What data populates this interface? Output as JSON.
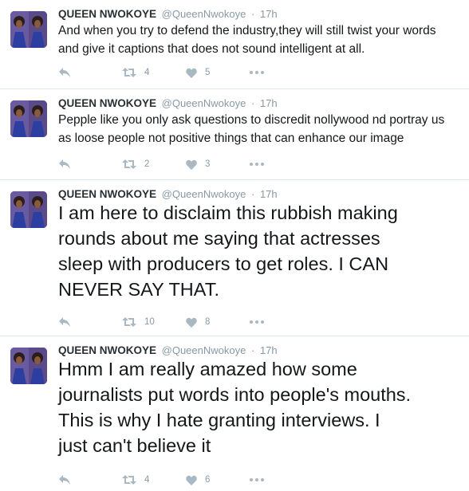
{
  "tweets": [
    {
      "name": "QUEEN NWOKOYE",
      "handle": "@QueenNwokoye",
      "separator": "·",
      "time": "17h",
      "text_line1": "And when you try to defend the industry,they will still twist your words",
      "text_line2": "and give it captions that does not sound intelligent at all.",
      "retweets": "4",
      "likes": "5"
    },
    {
      "name": "QUEEN NWOKOYE",
      "handle": "@QueenNwokoye",
      "separator": "·",
      "time": "17h",
      "text_line1": "Pepple like you only ask questions to discredit nollywood nd portray us",
      "text_line2": "as loose people not positive things that can enhance our image",
      "retweets": "2",
      "likes": "3"
    },
    {
      "name": "QUEEN NWOKOYE",
      "handle": "@QueenNwokoye",
      "separator": "·",
      "time": "17h",
      "text_line1": "I am here to disclaim this rubbish making",
      "text_line2": "rounds about me saying that actresses",
      "text_line3": "sleep with producers to get roles. I CAN",
      "text_line4": "NEVER SAY THAT.",
      "retweets": "10",
      "likes": "8"
    },
    {
      "name": "QUEEN NWOKOYE",
      "handle": "@QueenNwokoye",
      "separator": "·",
      "time": "17h",
      "text_line1": "Hmm I am really amazed how some",
      "text_line2": "journalists put words into people's mouths.",
      "text_line3": "This is why I hate granting interviews. I",
      "text_line4": "just can't believe it",
      "retweets": "4",
      "likes": "6"
    }
  ],
  "icons": {
    "reply": "reply-icon",
    "retweet": "retweet-icon",
    "like": "heart-icon",
    "more": "more-dots-icon"
  },
  "colors": {
    "name": "#292f33",
    "meta": "#8899a6",
    "icon": "#aab8c2",
    "divider": "#e1e8ed"
  }
}
